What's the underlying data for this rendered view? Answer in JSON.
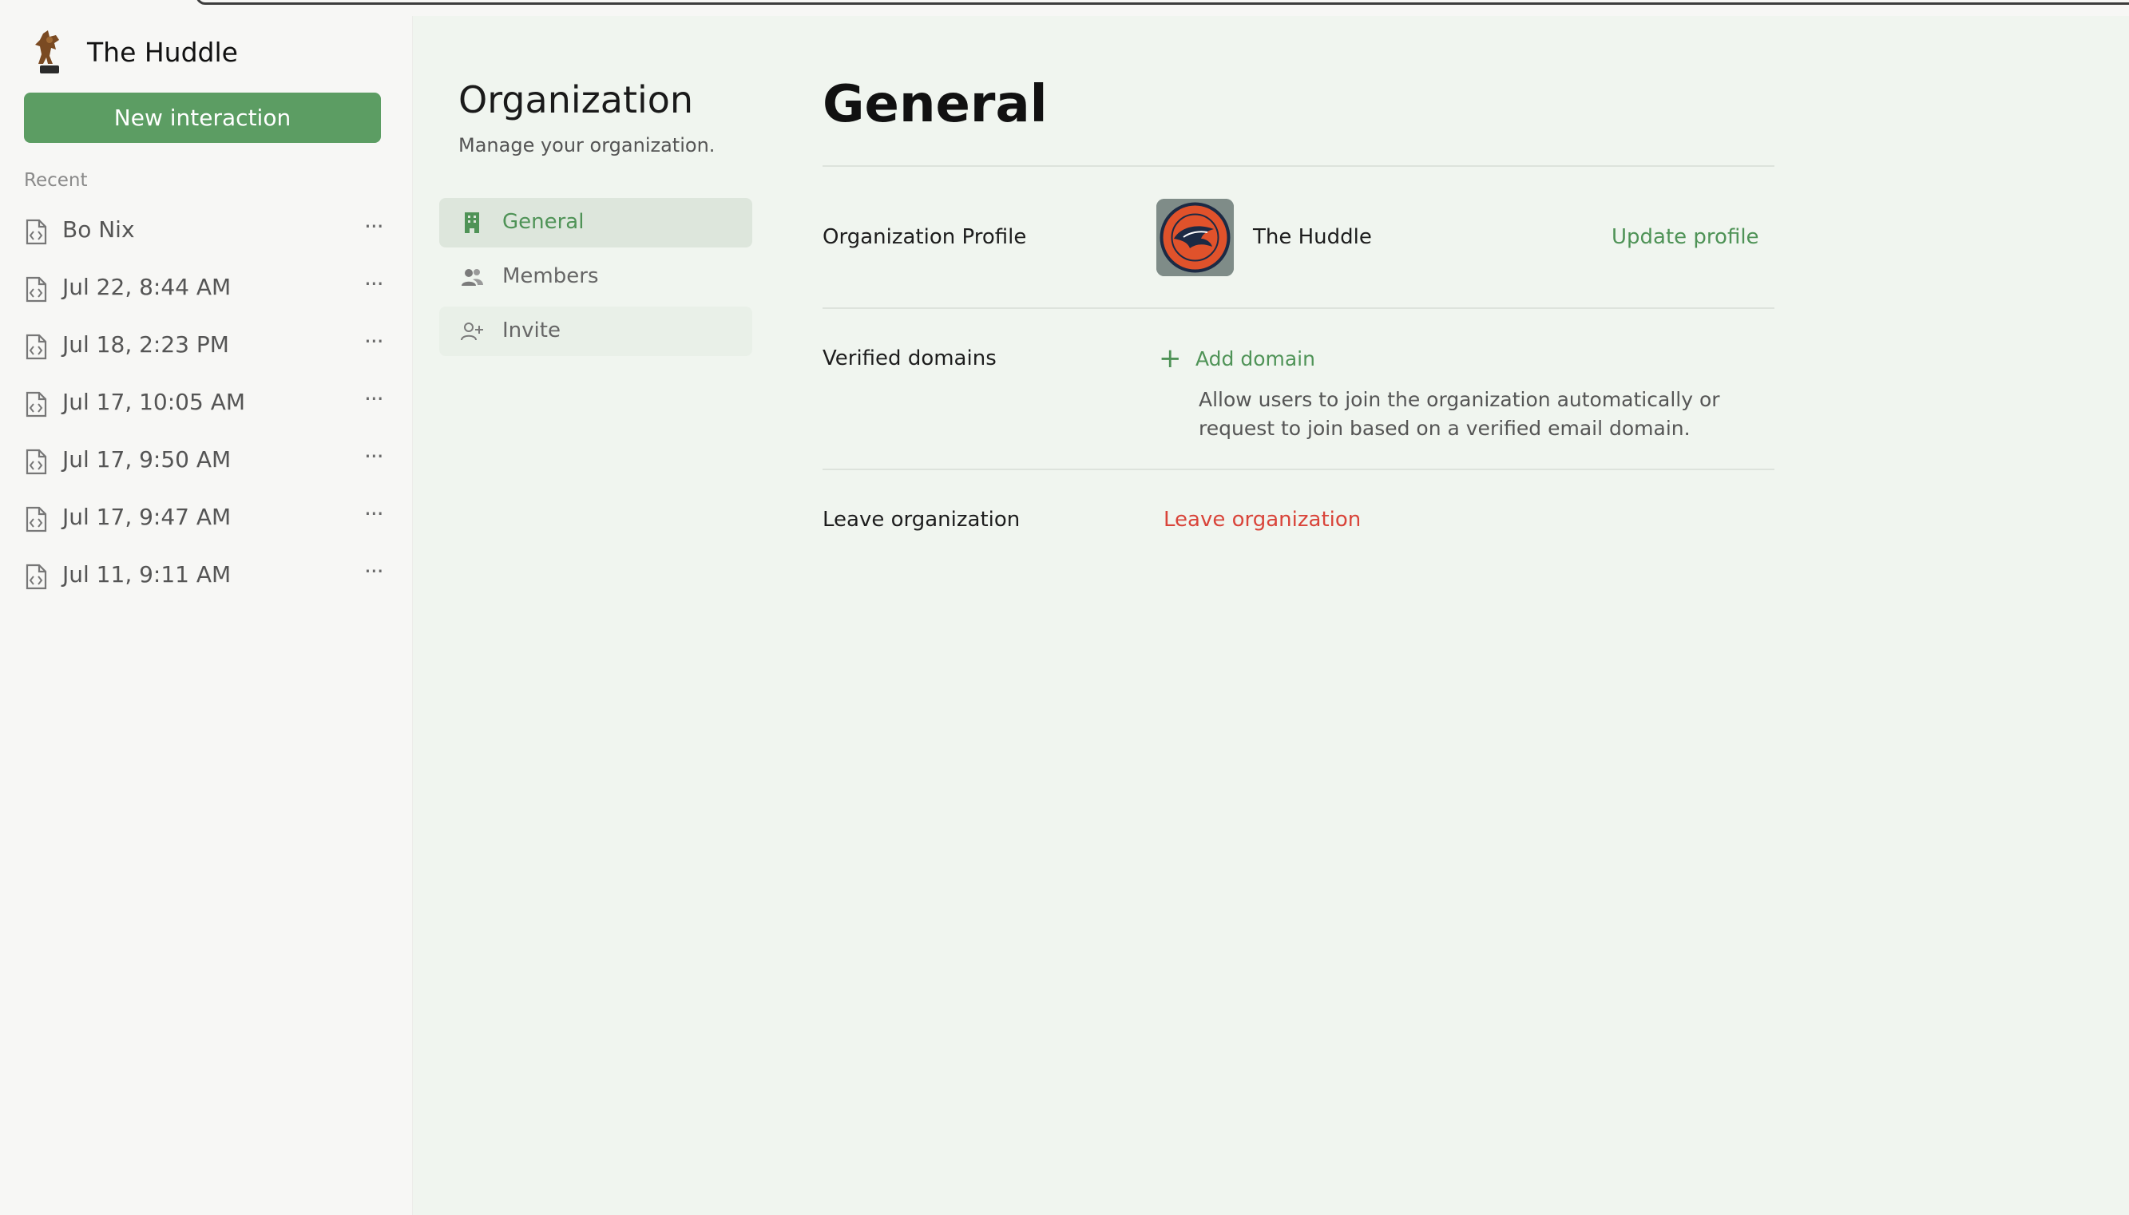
{
  "sidebar": {
    "brand_name": "The Huddle",
    "new_button_label": "New interaction",
    "recent_label": "Recent",
    "recent_items": [
      {
        "label": "Bo Nix"
      },
      {
        "label": "Jul 22, 8:44 AM"
      },
      {
        "label": "Jul 18, 2:23 PM"
      },
      {
        "label": "Jul 17, 10:05 AM"
      },
      {
        "label": "Jul 17, 9:50 AM"
      },
      {
        "label": "Jul 17, 9:47 AM"
      },
      {
        "label": "Jul 11, 9:11 AM"
      }
    ],
    "more_glyph": "···"
  },
  "org": {
    "title": "Organization",
    "subtitle": "Manage your organization.",
    "nav": [
      {
        "label": "General",
        "icon": "building-icon",
        "active": true
      },
      {
        "label": "Members",
        "icon": "users-icon",
        "active": false
      },
      {
        "label": "Invite",
        "icon": "user-plus-icon",
        "active": false
      }
    ]
  },
  "main": {
    "title": "General",
    "profile": {
      "label": "Organization Profile",
      "name": "The Huddle",
      "update_link": "Update profile"
    },
    "domains": {
      "label": "Verified domains",
      "add_plus": "+",
      "add_link": "Add domain",
      "description": "Allow users to join the organization automatically or request to join based on a verified email domain."
    },
    "leave": {
      "label": "Leave organization",
      "link": "Leave organization"
    }
  },
  "colors": {
    "accent": "#5c9d63",
    "accent_text": "#4f9357",
    "danger": "#d9443a",
    "background": "#f0f5ef",
    "sidebar_bg": "#f7f7f5"
  }
}
